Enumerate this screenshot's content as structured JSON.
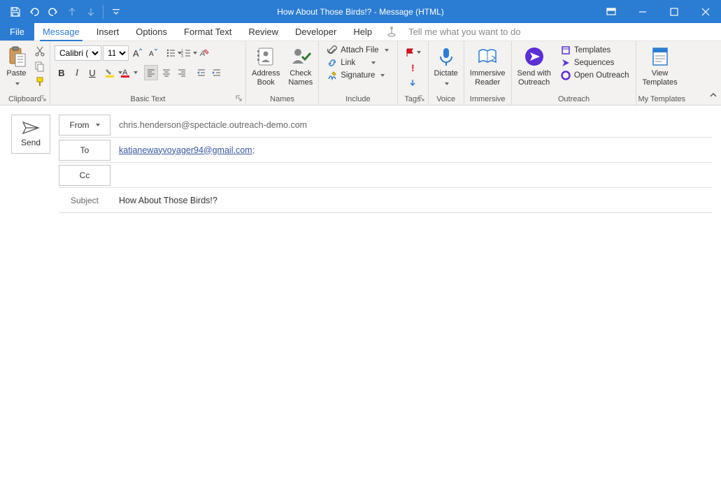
{
  "window": {
    "title": "How About Those Birds!?  -  Message (HTML)"
  },
  "tabs": {
    "file": "File",
    "message": "Message",
    "insert": "Insert",
    "options": "Options",
    "format_text": "Format Text",
    "review": "Review",
    "developer": "Developer",
    "help": "Help",
    "tell_me": "Tell me what you want to do"
  },
  "ribbon": {
    "clipboard": {
      "paste": "Paste",
      "label": "Clipboard"
    },
    "basic_text": {
      "label": "Basic Text",
      "font_name": "Calibri (Bod",
      "font_size": "11"
    },
    "names": {
      "address_book": "Address\nBook",
      "check_names": "Check\nNames",
      "label": "Names"
    },
    "include": {
      "attach_file": "Attach File",
      "link": "Link",
      "signature": "Signature",
      "label": "Include"
    },
    "tags": {
      "label": "Tags"
    },
    "voice": {
      "dictate": "Dictate",
      "label": "Voice"
    },
    "immersive": {
      "reader": "Immersive\nReader",
      "label": "Immersive"
    },
    "outreach": {
      "send_with": "Send with\nOutreach",
      "templates": "Templates",
      "sequences": "Sequences",
      "open_outreach": "Open Outreach",
      "label": "Outreach"
    },
    "my_templates": {
      "view_templates": "View\nTemplates",
      "label": "My Templates"
    }
  },
  "compose": {
    "send": "Send",
    "from_label": "From",
    "from_value": "chris.henderson@spectacle.outreach-demo.com",
    "to_label": "To",
    "to_value": "katjanewayvoyager94@gmail.com",
    "cc_label": "Cc",
    "cc_value": "",
    "subject_label": "Subject",
    "subject_value": "How About Those Birds!?"
  }
}
